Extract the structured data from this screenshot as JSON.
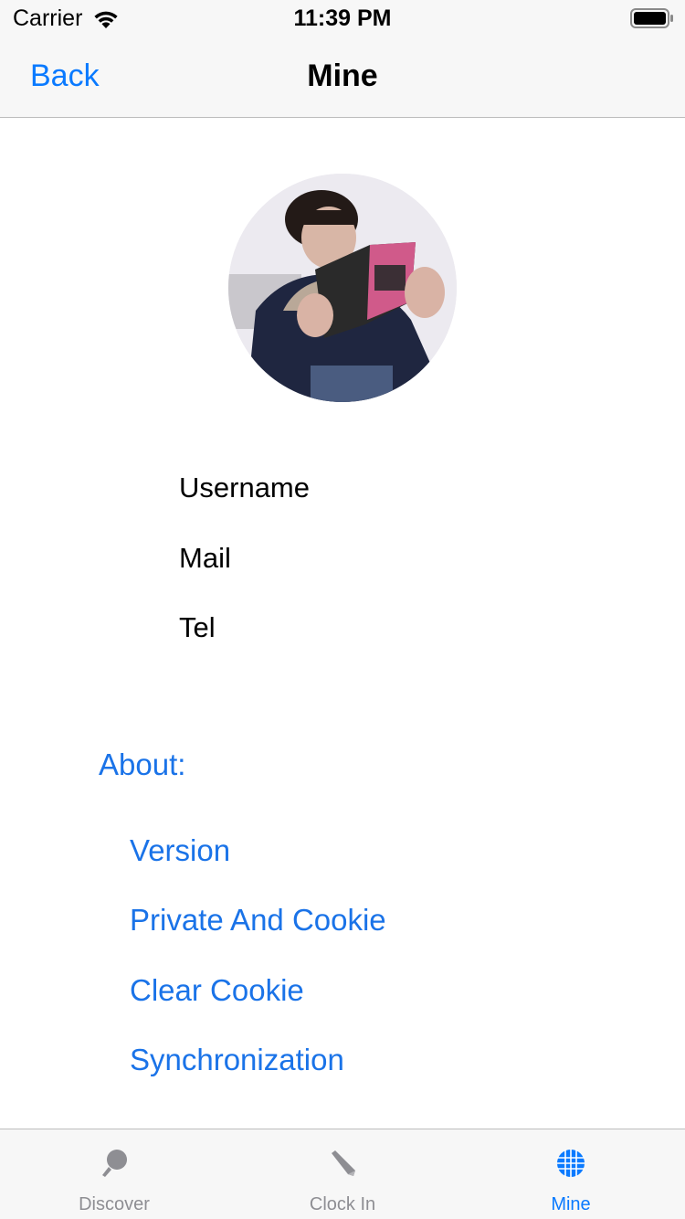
{
  "status_bar": {
    "carrier": "Carrier",
    "time": "11:39 PM",
    "wifi_icon": "wifi-icon",
    "battery_icon": "battery-icon"
  },
  "nav": {
    "back_label": "Back",
    "title": "Mine"
  },
  "profile": {
    "avatar_icon": "avatar-photo",
    "username_label": "Username",
    "mail_label": "Mail",
    "tel_label": "Tel"
  },
  "about": {
    "title": "About:",
    "items": [
      {
        "label": "Version"
      },
      {
        "label": "Private And Cookie"
      },
      {
        "label": "Clear Cookie"
      },
      {
        "label": "Synchronization"
      }
    ]
  },
  "tab_bar": {
    "tabs": [
      {
        "label": "Discover",
        "icon": "magnifier-icon",
        "active": false
      },
      {
        "label": "Clock In",
        "icon": "pen-icon",
        "active": false
      },
      {
        "label": "Mine",
        "icon": "globe-icon",
        "active": true
      }
    ]
  },
  "colors": {
    "accent": "#0a7aff",
    "link": "#1a73e8",
    "inactive_tab": "#8e8e93",
    "bar_background": "#f7f7f7"
  }
}
